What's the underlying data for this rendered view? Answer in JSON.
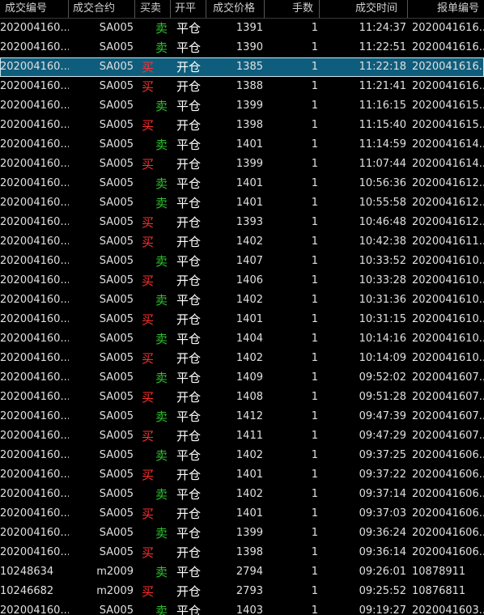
{
  "table": {
    "columns": [
      "成交编号",
      "成交合约",
      "买卖",
      "开平",
      "成交价格",
      "手数",
      "成交时间",
      "报单编号"
    ],
    "selected_row": 2,
    "rows": [
      {
        "id": "202004160...",
        "contract": "SA005",
        "side": "卖",
        "side_type": "sell",
        "oc": "平仓",
        "price": "1391",
        "qty": "1",
        "time": "11:24:37",
        "order": "2020041616..."
      },
      {
        "id": "202004160...",
        "contract": "SA005",
        "side": "卖",
        "side_type": "sell",
        "oc": "平仓",
        "price": "1390",
        "qty": "1",
        "time": "11:22:51",
        "order": "2020041616..."
      },
      {
        "id": "202004160...",
        "contract": "SA005",
        "side": "买",
        "side_type": "buy",
        "oc": "开仓",
        "price": "1385",
        "qty": "1",
        "time": "11:22:18",
        "order": "2020041616..."
      },
      {
        "id": "202004160...",
        "contract": "SA005",
        "side": "买",
        "side_type": "buy",
        "oc": "开仓",
        "price": "1388",
        "qty": "1",
        "time": "11:21:41",
        "order": "2020041616..."
      },
      {
        "id": "202004160...",
        "contract": "SA005",
        "side": "卖",
        "side_type": "sell",
        "oc": "平仓",
        "price": "1399",
        "qty": "1",
        "time": "11:16:15",
        "order": "2020041615..."
      },
      {
        "id": "202004160...",
        "contract": "SA005",
        "side": "买",
        "side_type": "buy",
        "oc": "开仓",
        "price": "1398",
        "qty": "1",
        "time": "11:15:40",
        "order": "2020041615..."
      },
      {
        "id": "202004160...",
        "contract": "SA005",
        "side": "卖",
        "side_type": "sell",
        "oc": "平仓",
        "price": "1401",
        "qty": "1",
        "time": "11:14:59",
        "order": "2020041614..."
      },
      {
        "id": "202004160...",
        "contract": "SA005",
        "side": "买",
        "side_type": "buy",
        "oc": "开仓",
        "price": "1399",
        "qty": "1",
        "time": "11:07:44",
        "order": "2020041614..."
      },
      {
        "id": "202004160...",
        "contract": "SA005",
        "side": "卖",
        "side_type": "sell",
        "oc": "平仓",
        "price": "1401",
        "qty": "1",
        "time": "10:56:36",
        "order": "2020041612..."
      },
      {
        "id": "202004160...",
        "contract": "SA005",
        "side": "卖",
        "side_type": "sell",
        "oc": "平仓",
        "price": "1401",
        "qty": "1",
        "time": "10:55:58",
        "order": "2020041612..."
      },
      {
        "id": "202004160...",
        "contract": "SA005",
        "side": "买",
        "side_type": "buy",
        "oc": "开仓",
        "price": "1393",
        "qty": "1",
        "time": "10:46:48",
        "order": "2020041612..."
      },
      {
        "id": "202004160...",
        "contract": "SA005",
        "side": "买",
        "side_type": "buy",
        "oc": "开仓",
        "price": "1402",
        "qty": "1",
        "time": "10:42:38",
        "order": "2020041611..."
      },
      {
        "id": "202004160...",
        "contract": "SA005",
        "side": "卖",
        "side_type": "sell",
        "oc": "平仓",
        "price": "1407",
        "qty": "1",
        "time": "10:33:52",
        "order": "2020041610..."
      },
      {
        "id": "202004160...",
        "contract": "SA005",
        "side": "买",
        "side_type": "buy",
        "oc": "开仓",
        "price": "1406",
        "qty": "1",
        "time": "10:33:28",
        "order": "2020041610..."
      },
      {
        "id": "202004160...",
        "contract": "SA005",
        "side": "卖",
        "side_type": "sell",
        "oc": "平仓",
        "price": "1402",
        "qty": "1",
        "time": "10:31:36",
        "order": "2020041610..."
      },
      {
        "id": "202004160...",
        "contract": "SA005",
        "side": "买",
        "side_type": "buy",
        "oc": "开仓",
        "price": "1401",
        "qty": "1",
        "time": "10:31:15",
        "order": "2020041610..."
      },
      {
        "id": "202004160...",
        "contract": "SA005",
        "side": "卖",
        "side_type": "sell",
        "oc": "平仓",
        "price": "1404",
        "qty": "1",
        "time": "10:14:16",
        "order": "2020041610..."
      },
      {
        "id": "202004160...",
        "contract": "SA005",
        "side": "买",
        "side_type": "buy",
        "oc": "开仓",
        "price": "1402",
        "qty": "1",
        "time": "10:14:09",
        "order": "2020041610..."
      },
      {
        "id": "202004160...",
        "contract": "SA005",
        "side": "卖",
        "side_type": "sell",
        "oc": "平仓",
        "price": "1409",
        "qty": "1",
        "time": "09:52:02",
        "order": "2020041607..."
      },
      {
        "id": "202004160...",
        "contract": "SA005",
        "side": "买",
        "side_type": "buy",
        "oc": "开仓",
        "price": "1408",
        "qty": "1",
        "time": "09:51:28",
        "order": "2020041607..."
      },
      {
        "id": "202004160...",
        "contract": "SA005",
        "side": "卖",
        "side_type": "sell",
        "oc": "平仓",
        "price": "1412",
        "qty": "1",
        "time": "09:47:39",
        "order": "2020041607..."
      },
      {
        "id": "202004160...",
        "contract": "SA005",
        "side": "买",
        "side_type": "buy",
        "oc": "开仓",
        "price": "1411",
        "qty": "1",
        "time": "09:47:29",
        "order": "2020041607..."
      },
      {
        "id": "202004160...",
        "contract": "SA005",
        "side": "卖",
        "side_type": "sell",
        "oc": "平仓",
        "price": "1402",
        "qty": "1",
        "time": "09:37:25",
        "order": "2020041606..."
      },
      {
        "id": "202004160...",
        "contract": "SA005",
        "side": "买",
        "side_type": "buy",
        "oc": "开仓",
        "price": "1401",
        "qty": "1",
        "time": "09:37:22",
        "order": "2020041606..."
      },
      {
        "id": "202004160...",
        "contract": "SA005",
        "side": "卖",
        "side_type": "sell",
        "oc": "平仓",
        "price": "1402",
        "qty": "1",
        "time": "09:37:14",
        "order": "2020041606..."
      },
      {
        "id": "202004160...",
        "contract": "SA005",
        "side": "买",
        "side_type": "buy",
        "oc": "开仓",
        "price": "1401",
        "qty": "1",
        "time": "09:37:03",
        "order": "2020041606..."
      },
      {
        "id": "202004160...",
        "contract": "SA005",
        "side": "卖",
        "side_type": "sell",
        "oc": "平仓",
        "price": "1399",
        "qty": "1",
        "time": "09:36:24",
        "order": "2020041606..."
      },
      {
        "id": "202004160...",
        "contract": "SA005",
        "side": "买",
        "side_type": "buy",
        "oc": "开仓",
        "price": "1398",
        "qty": "1",
        "time": "09:36:14",
        "order": "2020041606..."
      },
      {
        "id": "10248634",
        "contract": "m2009",
        "side": "卖",
        "side_type": "sell",
        "oc": "平仓",
        "price": "2794",
        "qty": "1",
        "time": "09:26:01",
        "order": "10878911"
      },
      {
        "id": "10246682",
        "contract": "m2009",
        "side": "买",
        "side_type": "buy",
        "oc": "开仓",
        "price": "2793",
        "qty": "1",
        "time": "09:25:52",
        "order": "10876811"
      },
      {
        "id": "202004160...",
        "contract": "SA005",
        "side": "卖",
        "side_type": "sell",
        "oc": "平仓",
        "price": "1403",
        "qty": "1",
        "time": "09:19:27",
        "order": "2020041603..."
      }
    ]
  }
}
